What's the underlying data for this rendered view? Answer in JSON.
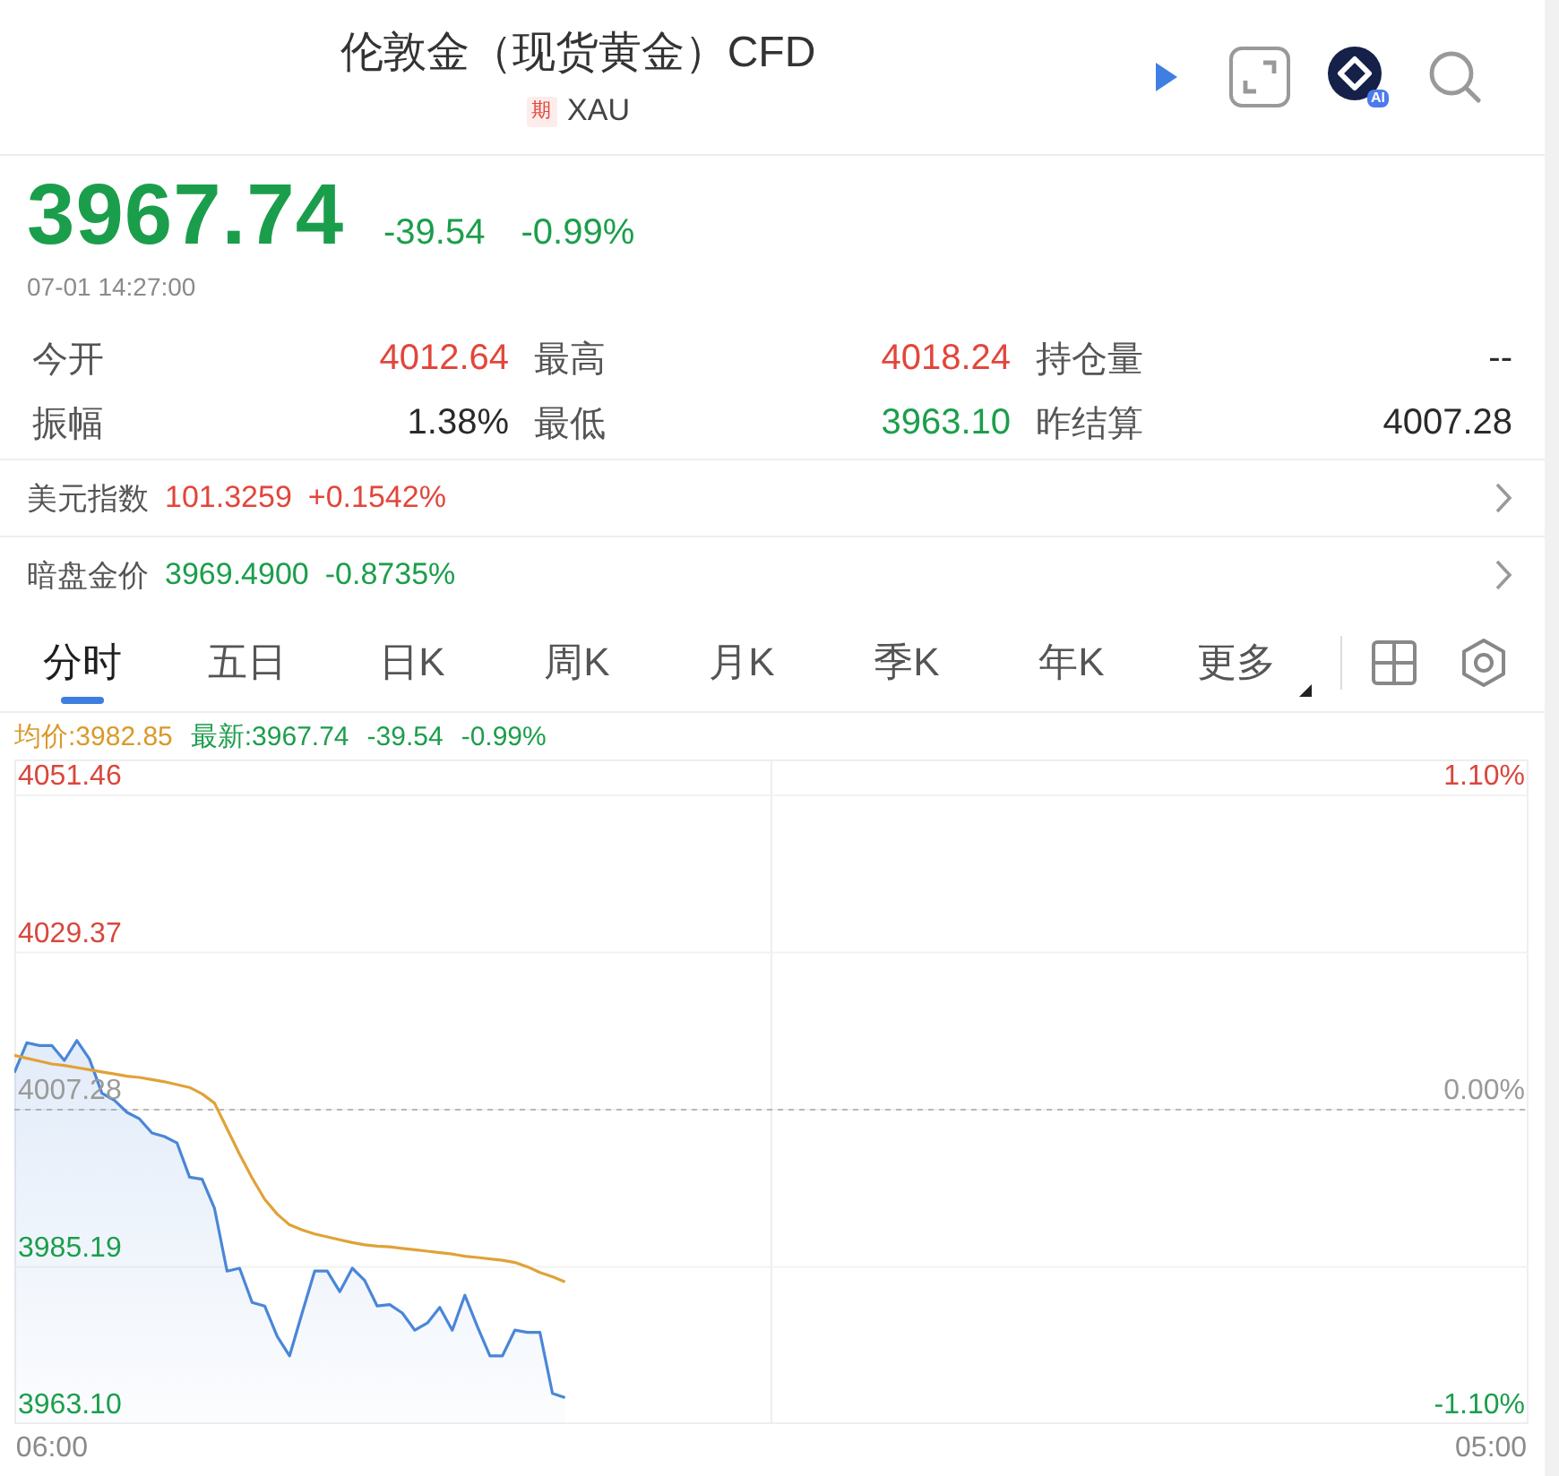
{
  "header": {
    "title": "伦敦金（现货黄金）CFD",
    "tag": "期",
    "symbol": "XAU",
    "ai_label": "AI"
  },
  "quote": {
    "price": "3967.74",
    "change": "-39.54",
    "change_pct": "-0.99%",
    "down": true,
    "time": "07-01 14:27:00"
  },
  "stats": [
    {
      "label": "今开",
      "value": "4012.64",
      "color": "#e2463b"
    },
    {
      "label": "最高",
      "value": "4018.24",
      "color": "#e2463b"
    },
    {
      "label": "持仓量",
      "value": "--",
      "color": "#2a2a2a"
    },
    {
      "label": "振幅",
      "value": "1.38%",
      "color": "#2a2a2a"
    },
    {
      "label": "最低",
      "value": "3963.10",
      "color": "#1b9e4b"
    },
    {
      "label": "昨结算",
      "value": "4007.28",
      "color": "#2a2a2a"
    }
  ],
  "related": [
    {
      "label": "美元指数",
      "price": "101.3259",
      "change": "+0.1542%",
      "color": "#e2463b"
    },
    {
      "label": "暗盘金价",
      "price": "3969.4900",
      "change": "-0.8735%",
      "color": "#1b9e4b"
    }
  ],
  "tabs": [
    {
      "label": "分时",
      "selected": true,
      "kind": "tab"
    },
    {
      "label": "五日",
      "selected": false,
      "kind": "tab"
    },
    {
      "label": "日K",
      "selected": false,
      "kind": "tab"
    },
    {
      "label": "周K",
      "selected": false,
      "kind": "tab"
    },
    {
      "label": "月K",
      "selected": false,
      "kind": "tab"
    },
    {
      "label": "季K",
      "selected": false,
      "kind": "tab"
    },
    {
      "label": "年K",
      "selected": false,
      "kind": "tab"
    },
    {
      "label": "更多",
      "selected": false,
      "kind": "menu"
    }
  ],
  "legend": [
    {
      "text": "均价:3982.85",
      "color": "#d99a2b"
    },
    {
      "text": "最新:3967.74",
      "color": "#1b9e4b"
    },
    {
      "text": "-39.54",
      "color": "#1b9e4b"
    },
    {
      "text": "-0.99%",
      "color": "#1b9e4b"
    }
  ],
  "chart": {
    "right_labels": [
      {
        "label": "1.10%",
        "color": "#d9473c"
      },
      {
        "label": "0.00%",
        "color": "#9a9a9a"
      },
      {
        "label": "-1.10%",
        "color": "#1b9e4b"
      }
    ],
    "chart_data": {
      "type": "line",
      "categories": [
        null,
        null,
        null,
        "06:00",
        null,
        null,
        null,
        null,
        null,
        null,
        null,
        null,
        null,
        null,
        null,
        null,
        null,
        null,
        null,
        null,
        null,
        null,
        null,
        null,
        null,
        null,
        null,
        null,
        null,
        null,
        null,
        null,
        null,
        null,
        null,
        null,
        null,
        null,
        null,
        null,
        null,
        null,
        null,
        null,
        null,
        null,
        null,
        null,
        null,
        null,
        null,
        null,
        null,
        null,
        null,
        null,
        null,
        null,
        null,
        null,
        null,
        null,
        null,
        null,
        null,
        null,
        null,
        null,
        null,
        null,
        null,
        null,
        null,
        null,
        null,
        null,
        null,
        null,
        null,
        null,
        null,
        null,
        null,
        null,
        null,
        null,
        null,
        null,
        null,
        null,
        null,
        null,
        null,
        null,
        null,
        null,
        null,
        null,
        null,
        null,
        null,
        null,
        null,
        null,
        null,
        null,
        null,
        null,
        null,
        null,
        null,
        null,
        null,
        null,
        null,
        null,
        null,
        null,
        "05:00",
        null,
        null,
        null
      ],
      "series": [
        {
          "color": "#4a86d8",
          "values": [
            4012.5,
            4016.7,
            4016.3,
            4016.3,
            4014.2,
            4017,
            4014.4,
            4009.6,
            4008.6,
            4006.9,
            4006,
            4004,
            4003.5,
            4002.6,
            3997.8,
            3997.5,
            3993.4,
            3984.6,
            3985,
            3980.2,
            3979.7,
            3975.4,
            3972.7,
            3978.7,
            3984.6,
            3984.6,
            3981.7,
            3985,
            3983.3,
            3979.7,
            3979.9,
            3978.7,
            3976.3,
            3977.3,
            3979.5,
            3976.3,
            3981.2,
            3976.8,
            3972.7,
            3972.7,
            3976.3,
            3976,
            3976,
            3967.4,
            3966.8,
            null,
            null,
            null,
            null,
            null,
            null,
            null,
            null,
            null,
            null,
            null,
            null,
            null,
            null,
            null,
            null,
            null,
            null,
            null,
            null,
            null,
            null,
            null,
            null,
            null,
            null,
            null,
            null,
            null,
            null,
            null,
            null,
            null,
            null,
            null,
            null,
            null,
            null,
            null,
            null,
            null,
            null,
            null,
            null,
            null,
            null,
            null,
            null,
            null,
            null,
            null,
            null,
            null,
            null,
            null,
            null,
            null,
            null,
            null,
            null,
            null,
            null,
            null,
            null,
            null,
            null,
            null,
            null,
            null,
            null,
            null,
            null,
            null,
            null,
            null,
            null,
            null
          ]
        },
        {
          "color": "#e0a238",
          "values": [
            4014.9,
            4014.5,
            4014.1,
            4013.7,
            4013.5,
            4013.2,
            4012.9,
            4012.6,
            4012.3,
            4012,
            4011.8,
            4011.5,
            4011.2,
            4010.8,
            4010.4,
            4009.5,
            4008.2,
            4004.6,
            4001,
            3997.7,
            3994.7,
            3992.6,
            3991.1,
            3990.4,
            3989.8,
            3989.4,
            3989,
            3988.6,
            3988.3,
            3988.1,
            3988,
            3987.8,
            3987.6,
            3987.4,
            3987.2,
            3987,
            3986.7,
            3986.5,
            3986.3,
            3986.1,
            3985.8,
            3985.2,
            3984.4,
            3983.8,
            3983.1,
            null,
            null,
            null,
            null,
            null,
            null,
            null,
            null,
            null,
            null,
            null,
            null,
            null,
            null,
            null,
            null,
            null,
            null,
            null,
            null,
            null,
            null,
            null,
            null,
            null,
            null,
            null,
            null,
            null,
            null,
            null,
            null,
            null,
            null,
            null,
            null,
            null,
            null,
            null,
            null,
            null,
            null,
            null,
            null,
            null,
            null,
            null,
            null,
            null,
            null,
            null,
            null,
            null,
            null,
            null,
            null,
            null,
            null,
            null,
            null,
            null,
            null,
            null,
            null,
            null,
            null,
            null,
            null,
            null,
            null,
            null,
            null,
            null,
            null,
            null,
            null,
            null
          ]
        }
      ],
      "ylim": [
        3963.1,
        4051.46
      ],
      "yticks": [
        {
          "value": 4051.46,
          "label": "4051.46"
        },
        {
          "value": 4029.37,
          "label": "4029.37"
        },
        {
          "value": 4007.28,
          "label": "4007.28"
        },
        {
          "value": 3985.19,
          "label": "3985.19"
        },
        {
          "value": 3963.1,
          "label": "3963.10"
        }
      ],
      "grid": true,
      "ref_lines": [
        {
          "axis": "y",
          "value": 4007.28
        }
      ]
    }
  }
}
